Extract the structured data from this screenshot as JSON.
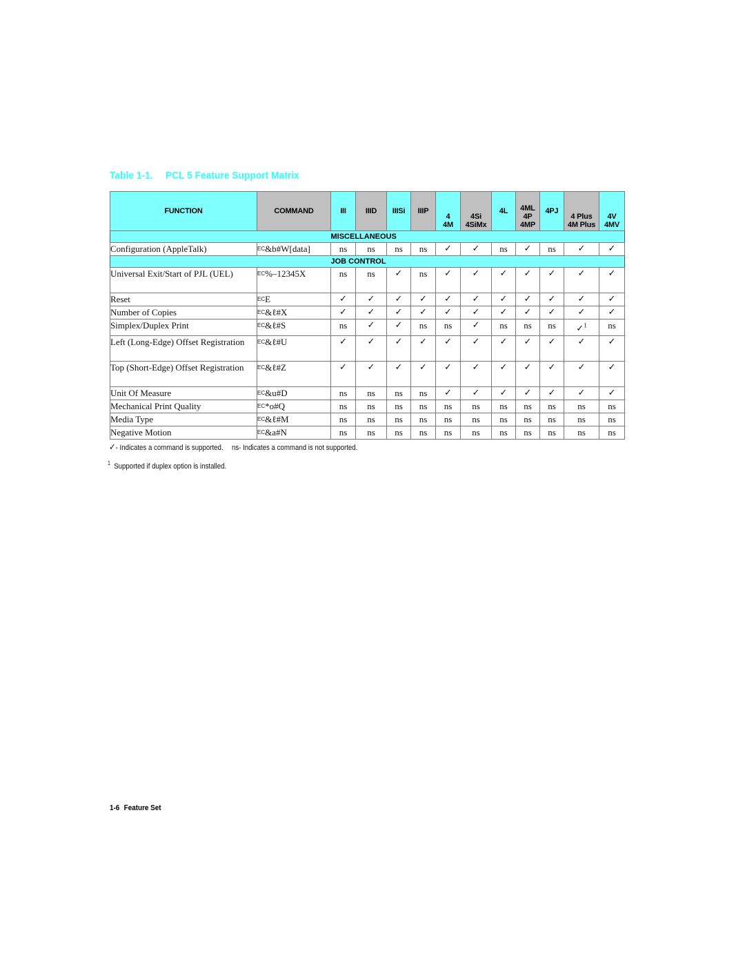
{
  "title": {
    "number": "Table 1-1.",
    "text": "PCL 5 Feature Support Matrix",
    "color": "#33ffff"
  },
  "columns": [
    {
      "key": "function",
      "lines": [
        "FUNCTION"
      ],
      "shade": "cyan"
    },
    {
      "key": "command",
      "lines": [
        "COMMAND"
      ],
      "shade": "gray"
    },
    {
      "key": "III",
      "lines": [
        "III"
      ],
      "shade": "cyan"
    },
    {
      "key": "IIID",
      "lines": [
        "IIID"
      ],
      "shade": "gray"
    },
    {
      "key": "IIISi",
      "lines": [
        "IIISi"
      ],
      "shade": "cyan"
    },
    {
      "key": "IIIP",
      "lines": [
        "IIIP"
      ],
      "shade": "gray"
    },
    {
      "key": "4",
      "lines": [
        "4",
        "4M"
      ],
      "shade": "cyan"
    },
    {
      "key": "4Si",
      "lines": [
        "4Si",
        "4SiMx"
      ],
      "shade": "gray"
    },
    {
      "key": "4L",
      "lines": [
        "4L"
      ],
      "shade": "cyan"
    },
    {
      "key": "4ML",
      "lines": [
        "4ML",
        "4P",
        "4MP"
      ],
      "shade": "gray"
    },
    {
      "key": "4PJ",
      "lines": [
        "4PJ"
      ],
      "shade": "cyan"
    },
    {
      "key": "4Plus",
      "lines": [
        "4 Plus",
        "4M Plus"
      ],
      "shade": "gray"
    },
    {
      "key": "4V",
      "lines": [
        "4V",
        "4MV"
      ],
      "shade": "cyan"
    }
  ],
  "colors": {
    "cyan": "#80ffff",
    "gray": "#c0c0c0"
  },
  "sections": [
    {
      "label": "MISCELLANEOUS",
      "rows": [
        {
          "function": "Configuration (AppleTalk)",
          "ec": "EC",
          "command": "&b#W[data]",
          "tall": false,
          "values": [
            "ns",
            "ns",
            "ns",
            "ns",
            "✓",
            "✓",
            "ns",
            "✓",
            "ns",
            "✓",
            "✓"
          ]
        }
      ]
    },
    {
      "label": "JOB CONTROL",
      "rows": [
        {
          "function": "Universal Exit/Start of PJL (UEL)",
          "ec": "EC",
          "command": "%–12345X",
          "tall": true,
          "values": [
            "ns",
            "ns",
            "✓",
            "ns",
            "✓",
            "✓",
            "✓",
            "✓",
            "✓",
            "✓",
            "✓"
          ]
        },
        {
          "function": "Reset",
          "ec": "EC",
          "command": "E",
          "tall": false,
          "values": [
            "✓",
            "✓",
            "✓",
            "✓",
            "✓",
            "✓",
            "✓",
            "✓",
            "✓",
            "✓",
            "✓"
          ]
        },
        {
          "function": "Number of Copies",
          "ec": "EC",
          "command": "&ℓ#X",
          "tall": false,
          "values": [
            "✓",
            "✓",
            "✓",
            "✓",
            "✓",
            "✓",
            "✓",
            "✓",
            "✓",
            "✓",
            "✓"
          ]
        },
        {
          "function": "Simplex/Duplex Print",
          "ec": "EC",
          "command": "&ℓ#S",
          "tall": false,
          "values": [
            "ns",
            "✓",
            "✓",
            "ns",
            "ns",
            "✓",
            "ns",
            "ns",
            "ns",
            "✓¹",
            "ns"
          ]
        },
        {
          "function": "Left (Long-Edge) Offset Registration",
          "ec": "EC",
          "command": "&ℓ#U",
          "tall": true,
          "values": [
            "✓",
            "✓",
            "✓",
            "✓",
            "✓",
            "✓",
            "✓",
            "✓",
            "✓",
            "✓",
            "✓"
          ]
        },
        {
          "function": "Top (Short-Edge) Offset Registration",
          "ec": "EC",
          "command": "&ℓ#Z",
          "tall": true,
          "values": [
            "✓",
            "✓",
            "✓",
            "✓",
            "✓",
            "✓",
            "✓",
            "✓",
            "✓",
            "✓",
            "✓"
          ]
        },
        {
          "function": "Unit Of Measure",
          "ec": "EC",
          "command": "&u#D",
          "tall": false,
          "values": [
            "ns",
            "ns",
            "ns",
            "ns",
            "✓",
            "✓",
            "✓",
            "✓",
            "✓",
            "✓",
            "✓"
          ]
        },
        {
          "function": "Mechanical Print Quality",
          "ec": "EC",
          "command": "*o#Q",
          "tall": false,
          "values": [
            "ns",
            "ns",
            "ns",
            "ns",
            "ns",
            "ns",
            "ns",
            "ns",
            "ns",
            "ns",
            "ns"
          ]
        },
        {
          "function": "Media Type",
          "ec": "EC",
          "command": "&ℓ#M",
          "tall": false,
          "values": [
            "ns",
            "ns",
            "ns",
            "ns",
            "ns",
            "ns",
            "ns",
            "ns",
            "ns",
            "ns",
            "ns"
          ]
        },
        {
          "function": "Negative Motion",
          "ec": "EC",
          "command": "&a#N",
          "tall": false,
          "values": [
            "ns",
            "ns",
            "ns",
            "ns",
            "ns",
            "ns",
            "ns",
            "ns",
            "ns",
            "ns",
            "ns"
          ]
        }
      ]
    }
  ],
  "legend": {
    "supported_symbol": "✓",
    "supported_text": "- Indicates a command is supported.",
    "unsupported_text": "ns- Indicates a command is not supported."
  },
  "footnote": {
    "marker": "1",
    "text": "Supported if duplex option is installed."
  },
  "page_footer": {
    "page_number": "1-6",
    "section": "Feature Set"
  }
}
